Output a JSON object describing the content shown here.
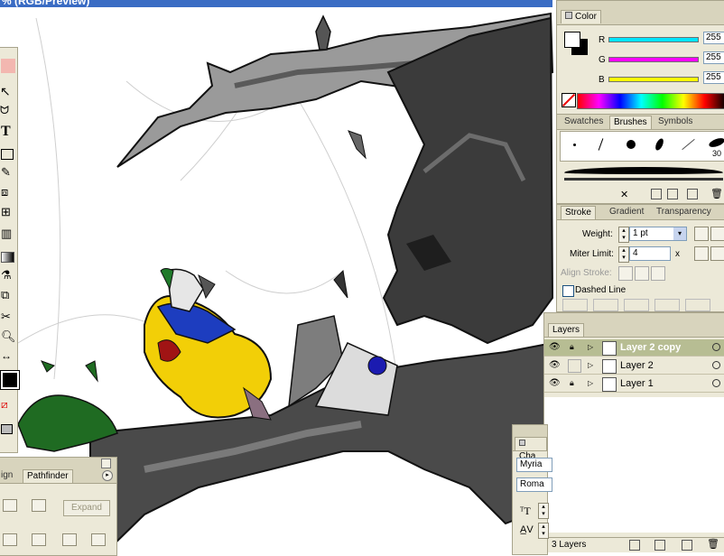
{
  "window": {
    "title_fragment": "% (RGB/Preview)"
  },
  "color_panel": {
    "title": "Color",
    "r_label": "R",
    "g_label": "G",
    "b_label": "B",
    "r_value": "255",
    "g_value": "255",
    "b_value": "255"
  },
  "brushes_panel": {
    "tabs": [
      "Swatches",
      "Brushes",
      "Symbols"
    ],
    "active_tab": "Brushes",
    "brush_size_label": "30"
  },
  "stroke_panel": {
    "tabs": [
      "Stroke",
      "Gradient",
      "Transparency"
    ],
    "weight_label": "Weight:",
    "weight_value": "1 pt",
    "miter_label": "Miter Limit:",
    "miter_value": "4",
    "miter_unit": "x",
    "align_label": "Align Stroke:",
    "dashed_label": "Dashed Line"
  },
  "layers_panel": {
    "title": "Layers",
    "layers": [
      {
        "name": "Layer 2 copy",
        "selected": true
      },
      {
        "name": "Layer 2",
        "selected": false
      },
      {
        "name": "Layer 1",
        "selected": false
      }
    ],
    "footer": "3 Layers"
  },
  "pathfinder_panel": {
    "tabs": [
      "ign",
      "Pathfinder"
    ],
    "active_tab": "Pathfinder",
    "expand_label": "Expand"
  },
  "character_panel": {
    "tab_fragment": "Cha",
    "font_family": "Myria",
    "font_style": "Roma"
  },
  "colors": {
    "panel_bg": "#ece9d8",
    "cyan": "#00e5ff",
    "magenta": "#ff00ff",
    "yellow": "#ffff00",
    "layer_selected": "#b7bd93"
  }
}
